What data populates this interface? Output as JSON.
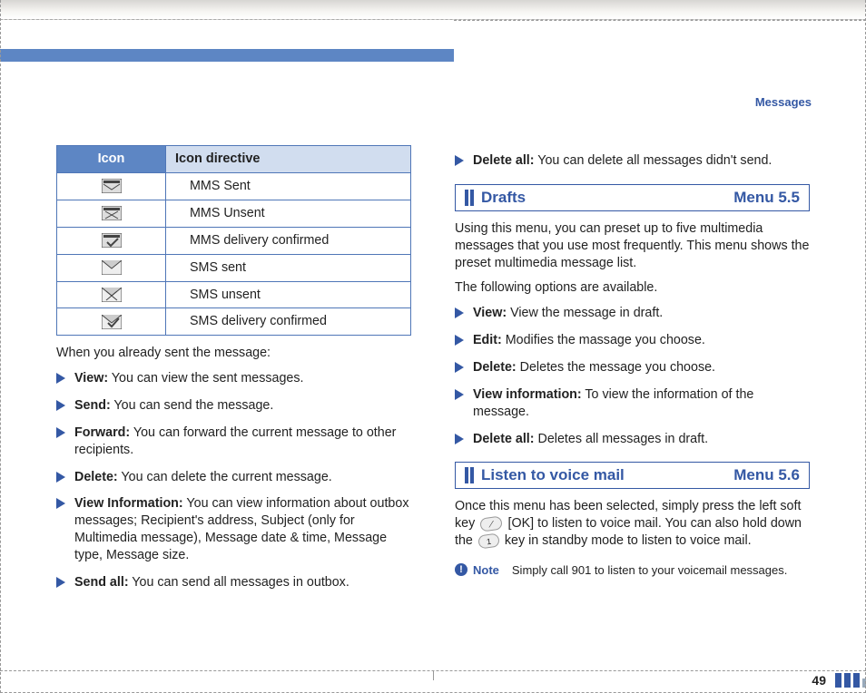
{
  "header": {
    "section_label": "Messages"
  },
  "icon_table": {
    "col1_header": "Icon",
    "col2_header": "Icon directive",
    "rows": [
      {
        "icon_name": "mms-sent-icon",
        "label": "MMS Sent"
      },
      {
        "icon_name": "mms-unsent-icon",
        "label": "MMS Unsent"
      },
      {
        "icon_name": "mms-delivery-confirmed-icon",
        "label": "MMS delivery confirmed"
      },
      {
        "icon_name": "sms-sent-icon",
        "label": "SMS sent"
      },
      {
        "icon_name": "sms-unsent-icon",
        "label": "SMS unsent"
      },
      {
        "icon_name": "sms-delivery-confirmed-icon",
        "label": "SMS delivery confirmed"
      }
    ]
  },
  "left": {
    "intro": "When you already sent the message:",
    "items": [
      {
        "term": "View:",
        "desc": " You can view the sent messages."
      },
      {
        "term": "Send:",
        "desc": " You can send the message."
      },
      {
        "term": "Forward:",
        "desc": " You can forward the current message to other recipients."
      },
      {
        "term": "Delete:",
        "desc": " You can delete the current message."
      },
      {
        "term": "View Information:",
        "desc": " You can view information about outbox messages; Recipient's address, Subject (only for Multimedia message), Message date & time, Message type, Message size."
      },
      {
        "term": "Send all:",
        "desc": " You can send all messages in outbox."
      }
    ]
  },
  "right": {
    "top_item": {
      "term": "Delete all:",
      "desc": " You can delete all messages didn't send."
    },
    "drafts": {
      "title": "Drafts",
      "menu": "Menu 5.5",
      "para1": "Using this menu, you can preset up to five multimedia messages that you use most frequently. This menu shows the preset multimedia message list.",
      "para2": "The following options are available.",
      "items": [
        {
          "term": "View:",
          "desc": " View the message in draft."
        },
        {
          "term": "Edit:",
          "desc": " Modifies the massage you choose."
        },
        {
          "term": "Delete:",
          "desc": " Deletes the message you choose."
        },
        {
          "term": "View information:",
          "desc": " To view the information of the message."
        },
        {
          "term": "Delete all:",
          "desc": " Deletes all messages in draft."
        }
      ]
    },
    "voicemail": {
      "title": "Listen to voice mail",
      "menu": "Menu 5.6",
      "para_a": "Once this menu has been selected, simply press the left soft key ",
      "key1": "[OK]",
      "para_b": " to listen to voice mail. You can also hold down the ",
      "key2": "1",
      "para_c": " key in standby mode to listen to voice mail."
    },
    "note": {
      "label": "Note",
      "text": "Simply call 901 to listen to your voicemail messages."
    }
  },
  "page_number": "49"
}
